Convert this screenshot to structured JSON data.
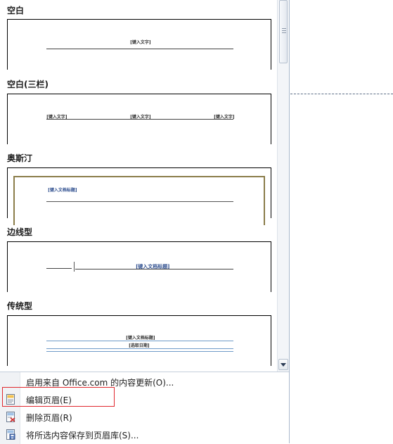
{
  "gallery": {
    "sections": [
      {
        "title": "空白",
        "placeholders": [
          "[键入文字]"
        ]
      },
      {
        "title": "空白(三栏)",
        "placeholders": [
          "[键入文字]",
          "[键入文字]",
          "[键入文字]"
        ]
      },
      {
        "title": "奥斯汀",
        "placeholders": [
          "[键入文档标题]"
        ]
      },
      {
        "title": "边线型",
        "placeholders": [
          "[键入文档标题]"
        ]
      },
      {
        "title": "传统型",
        "placeholders": [
          "[键入文档标题]",
          "[选取日期]"
        ]
      }
    ]
  },
  "menu": {
    "items": [
      {
        "label": "启用来自 Office.com 的内容更新(O)...",
        "icon": "none"
      },
      {
        "label": "编辑页眉(E)",
        "icon": "edit-header-icon"
      },
      {
        "label": "删除页眉(R)",
        "icon": "remove-header-icon"
      },
      {
        "label": "将所选内容保存到页眉库(S)...",
        "icon": "save-to-gallery-icon"
      }
    ]
  },
  "colors": {
    "highlight_border": "#e0282e",
    "austin_frame": "#8b7d4a",
    "placeholder_blue": "#2f4f8f",
    "traditional_lines": "#6f9bc8"
  }
}
